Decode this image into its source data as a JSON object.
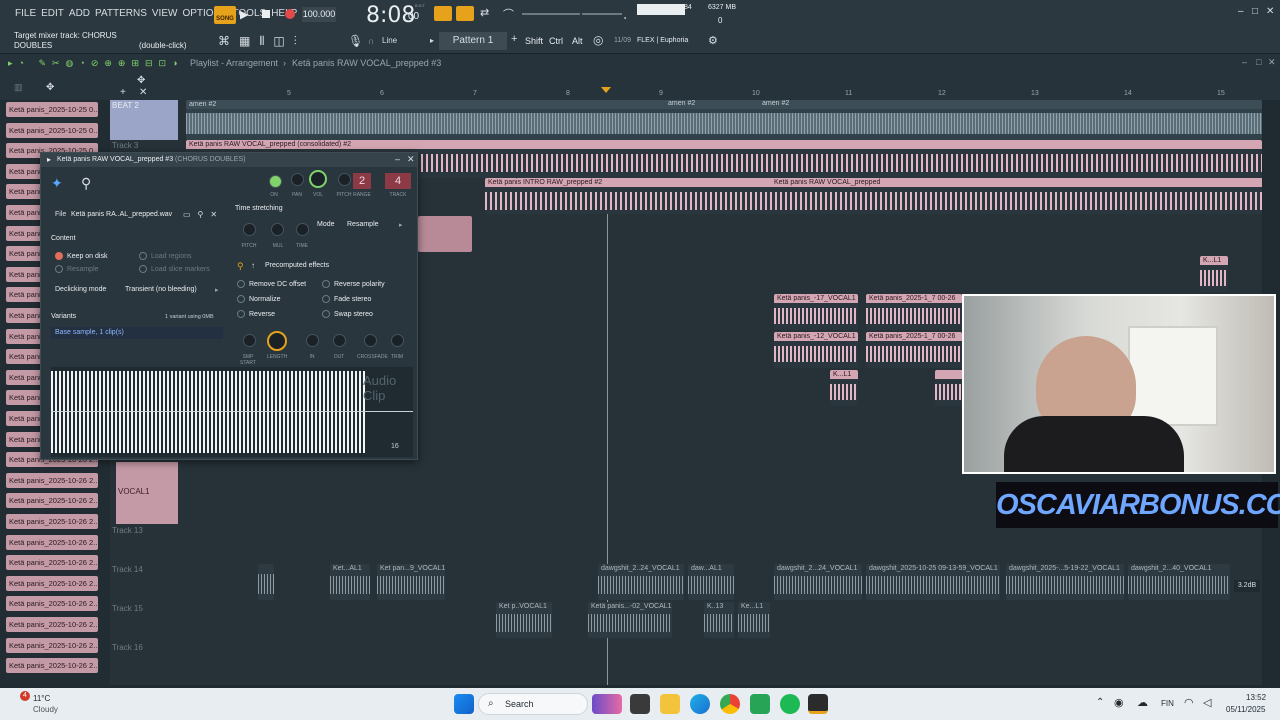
{
  "menu": [
    "FILE",
    "EDIT",
    "ADD",
    "PATTERNS",
    "VIEW",
    "OPTIONS",
    "TOOLS",
    "HELP"
  ],
  "transport": {
    "song_label": "SONG",
    "tempo": "100.000",
    "time": "8:08",
    "time_ms": "00",
    "time_unit": "B:S:T",
    "cpu": "84",
    "mem": "6327 MB",
    "voices": "0"
  },
  "hint": {
    "line1": "Target mixer track: CHORUS",
    "line2": "DOUBLES",
    "action": "(double-click)"
  },
  "toolbar": {
    "snap": "Line",
    "pattern": "Pattern 1",
    "shift": "Shift",
    "ctrl": "Ctrl",
    "alt": "Alt",
    "preset_info": "11/09",
    "preset_name": "FLEX | Euphoria"
  },
  "playlist": {
    "breadcrumb1": "Playlist - Arrangement",
    "breadcrumb2": "Ketä panis RAW VOCAL_prepped #3"
  },
  "ruler": [
    "5",
    "6",
    "7",
    "8",
    "9",
    "10",
    "11",
    "12",
    "13",
    "14",
    "15"
  ],
  "tracks": {
    "beat": "BEAT 2",
    "t3": "Track 3",
    "vocal1": "VOCAL1",
    "t13": "Track 13",
    "t14": "Track 14",
    "t15": "Track 15",
    "t16": "Track 16"
  },
  "left_clips": [
    "Ketä panis_2025-10-25 0..",
    "Ketä panis_2025-10-25 0..",
    "Ketä panis_2025-10-25 0..",
    "Ketä panis",
    "Ketä panis",
    "Ketä panis",
    "Ketä panis",
    "Ketä panis",
    "Ketä panis",
    "Ketä panis",
    "Ketä panis",
    "Ketä panis",
    "Ketä panis",
    "Ketä panis",
    "Ketä panis",
    "Ketä panis",
    "Ketä panis",
    "Ketä panis_2025-10-26 2..",
    "Ketä panis_2025-10-26 2..",
    "Ketä panis_2025-10-26 2..",
    "Ketä panis_2025-10-26 2..",
    "Ketä panis_2025-10-26 2..",
    "Ketä panis_2025-10-26 2..",
    "Ketä panis_2025-10-26 2..",
    "Ketä panis_2025-10-26 2..",
    "Ketä panis_2025-10-26 2..",
    "Ketä panis_2025-10-26 2..",
    "Ketä panis_2025-10-26 2.."
  ],
  "clips": {
    "amen1": "amen #2",
    "amen2": "amen #2",
    "amen3": "amen #2",
    "consolidated": "Ketä panis RAW VOCAL_prepped (consolidated) #2",
    "intro": "Ketä panis INTRO RAW_prepped #2",
    "raw": "Ketä panis RAW VOCAL_prepped",
    "k17": "Ketä panis_-17_VOCAL1",
    "k2025a": "Ketä panis_2025-1_7 00-26",
    "k12": "Ketä panis_-12_VOCAL1",
    "k2025b": "Ketä panis_2025-1_7 00-26",
    "kl1": "K...L1",
    "kl2": "K...L1",
    "dawg1": "dawgshit_2..24_VOCAL1",
    "daw2": "daw...AL1",
    "dawg3": "dawgshit_2...24_VOCAL1",
    "dawg4": "dawgshit_2025-10-25 09-13-59_VOCAL1",
    "dawg5": "dawgshit_2025-...5-19-22_VOCAL1",
    "dawg6": "dawgshit_2...40_VOCAL1",
    "ket1": "Ket...AL1",
    "ketpan": "Ket pan...9_VOCAL1",
    "ketp": "Ket p..VOCAL1",
    "ketpanis02": "Ketä panis...-02_VOCAL1",
    "k13": "K..13",
    "ke11": "Ke...L1",
    "db": "3.2dB"
  },
  "sampler": {
    "title": "Ketä panis RAW VOCAL_prepped #3",
    "subtitle": "(CHORUS DOUBLES)",
    "file_label": "File",
    "file_name": "Ketä panis RA..AL_prepped.wav",
    "content": "Content",
    "keep": "Keep on disk",
    "resample": "Resample",
    "load_regions": "Load regions",
    "load_slice": "Load slice markers",
    "declick_label": "Declicking mode",
    "declick_value": "Transient (no bleeding)",
    "variants": "Variants",
    "variants_info": "1 variant using 0MB",
    "base_sample": "Base sample, 1 clip(s)",
    "time_stretch": "Time stretching",
    "mode_label": "Mode",
    "mode_value": "Resample",
    "precomputed": "Precomputed effects",
    "fx": [
      "Remove DC offset",
      "Normalize",
      "Reverse"
    ],
    "fx2": [
      "Reverse polarity",
      "Fade stereo",
      "Swap stereo"
    ],
    "knobs_top": [
      "ON",
      "PAN",
      "VOL",
      "PITCH",
      "RANGE",
      "TRACK"
    ],
    "range_val": "2",
    "track_val": "4",
    "stretch_knobs": [
      "PITCH",
      "MUL",
      "TIME"
    ],
    "bottom_knobs": [
      "SMP START",
      "LENGTH",
      "IN",
      "OUT",
      "CROSSFADE",
      "TRIM"
    ],
    "audio_clip": "Audio Clip",
    "footer_num": "16"
  },
  "brand": "OSCAVIARBONUS.COM",
  "taskbar": {
    "temp": "11°C",
    "weather": "Cloudy",
    "badge": "4",
    "search": "Search",
    "lang": "FIN",
    "time": "13:52",
    "date": "05/11/2025"
  }
}
